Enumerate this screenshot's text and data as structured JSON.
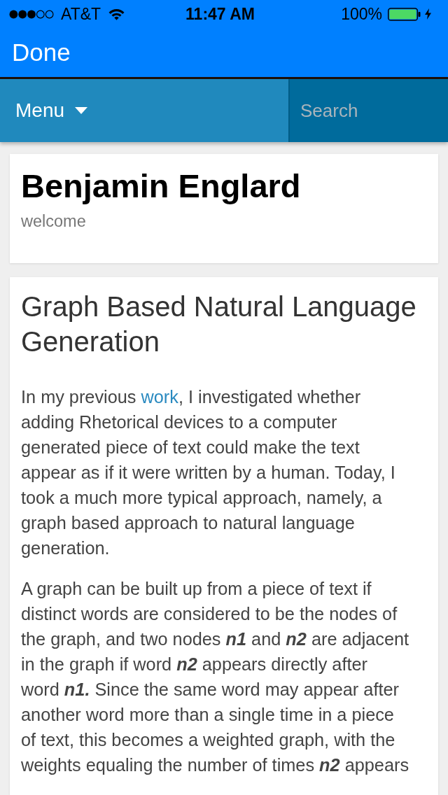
{
  "status_bar": {
    "carrier": "AT&T",
    "time": "11:47 AM",
    "battery": "100%"
  },
  "nav_bar": {
    "done_button": "Done"
  },
  "site_header": {
    "menu_button": "Menu",
    "search": {
      "placeholder": "Search"
    }
  },
  "profile_card": {
    "name": "Benjamin Englard",
    "tagline": "welcome"
  },
  "post": {
    "title": "Graph Based Natural Language Generation",
    "paragraphs": [
      {
        "parts": [
          {
            "kind": "text",
            "text": "In my previous "
          },
          {
            "kind": "link",
            "text": "work"
          },
          {
            "kind": "text",
            "text": ", I investigated whether adding Rhetorical devices to a computer generated piece of text could make the text appear as if it were written by a human. Today, I took a much more typical approach, namely, a graph based approach to natural language generation."
          }
        ]
      },
      {
        "parts": [
          {
            "kind": "text",
            "text": "A graph can be built up from a piece of text if distinct words are considered to be the nodes of the graph, and two nodes **n1** and **n2** are adjacent in the graph if word **n2** appears directly after word **n1.** Since the same word may appear after another word more than a single time in a piece of text, this becomes a weighted graph, with the weights equaling the number of times **n2** appears"
          }
        ]
      }
    ]
  }
}
